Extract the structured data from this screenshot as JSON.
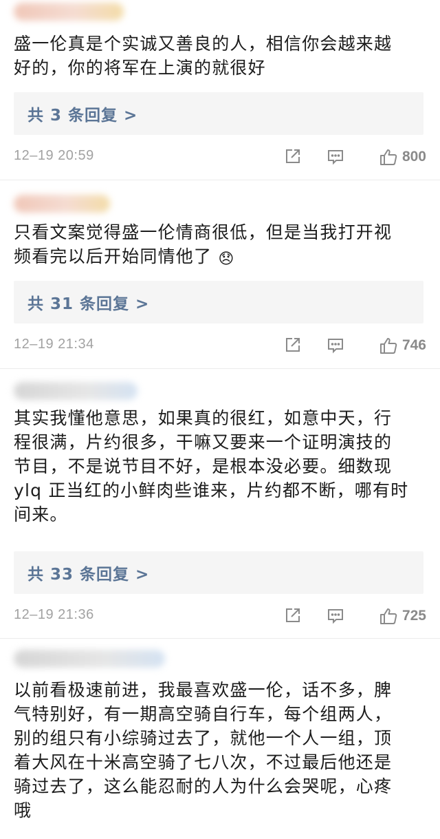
{
  "comments": [
    {
      "text": "盛一伦真是个实诚又善良的人，相信你会越来越\n好的，你的将军在上演的就很好",
      "replies": "共 3 条回复 >",
      "time": "12–19 20:59",
      "likes": "800"
    },
    {
      "text": "只看文案觉得盛一伦情商很低，但是当我打开视\n频看完以后开始同情他了",
      "emoji": "😞",
      "replies": "共 31 条回复 >",
      "time": "12–19 21:34",
      "likes": "746"
    },
    {
      "text": "其实我懂他意思，如果真的很红，如意中天，行\n程很满，片约很多，干嘛又要来一个证明演技的\n节目，不是说节目不好，是根本没必要。细数现\nylq 正当红的小鲜肉些谁来，片约都不断，哪有时\n间来。",
      "replies": "共 33 条回复 >",
      "time": "12–19 21:36",
      "likes": "725"
    },
    {
      "text": "以前看极速前进，我最喜欢盛一伦，话不多，脾\n气特别好，有一期高空骑自行车，每个组两人，\n别的组只有小综骑过去了，就他一个人一组，顶\n着大风在十米高空骑了七八次，不过最后他还是\n骑过去了，这么能忍耐的人为什么会哭呢，心疼\n哦"
    }
  ],
  "icons": {
    "share": "share-icon",
    "comment": "comment-icon",
    "like": "thumbs-up-icon"
  },
  "colors": {
    "reply_link": "#5b7596",
    "meta_text": "#a2a2a2",
    "reply_bg": "#f5f5f5"
  }
}
